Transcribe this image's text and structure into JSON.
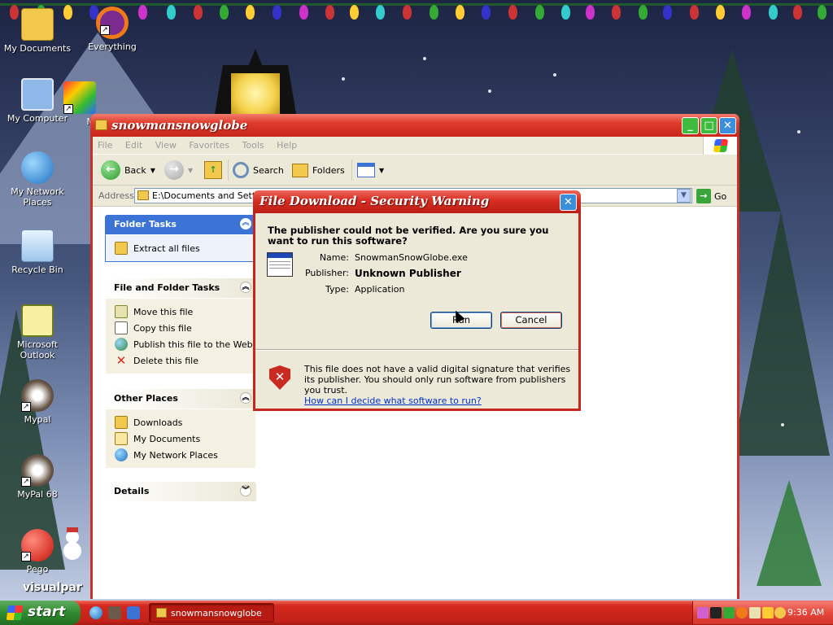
{
  "desktop": {
    "icons": [
      {
        "label": "My Documents"
      },
      {
        "label": "Everything"
      },
      {
        "label": "My Computer"
      },
      {
        "label": "M"
      },
      {
        "label": "My Network Places"
      },
      {
        "label": "Recycle Bin"
      },
      {
        "label": "Microsoft Outlook"
      },
      {
        "label": "Mypal"
      },
      {
        "label": "MyPal 68"
      },
      {
        "label": "Pego"
      },
      {
        "label": "visualpar"
      }
    ]
  },
  "explorer": {
    "title": "snowmansnowglobe",
    "menu": [
      "File",
      "Edit",
      "View",
      "Favorites",
      "Tools",
      "Help"
    ],
    "toolbar": {
      "back": "Back",
      "search": "Search",
      "folders": "Folders"
    },
    "address": {
      "label": "Address",
      "value": "E:\\Documents and Settings",
      "go": "Go"
    },
    "panels": {
      "folder_tasks": {
        "title": "Folder Tasks",
        "items": [
          "Extract all files"
        ]
      },
      "file_folder_tasks": {
        "title": "File and Folder Tasks",
        "items": [
          "Move this file",
          "Copy this file",
          "Publish this file to the Web",
          "Delete this file"
        ]
      },
      "other_places": {
        "title": "Other Places",
        "items": [
          "Downloads",
          "My Documents",
          "My Network Places"
        ]
      },
      "details": {
        "title": "Details"
      }
    }
  },
  "dialog": {
    "title": "File Download - Security Warning",
    "question": "The publisher could not be verified.  Are you sure you want to run this software?",
    "name_label": "Name:",
    "name_value": "SnowmanSnowGlobe.exe",
    "publisher_label": "Publisher:",
    "publisher_value": "Unknown Publisher",
    "type_label": "Type:",
    "type_value": "Application",
    "run_label": "Run",
    "cancel_label": "Cancel",
    "warning_text": "This file does not have a valid digital signature that verifies its publisher.  You should only run software from publishers you trust.",
    "help_link": "How can I decide what software to run?"
  },
  "taskbar": {
    "start_label": "start",
    "task_button": "snowmansnowglobe",
    "clock": "9:36 AM"
  },
  "colors": {
    "title_red": "#d62d22",
    "taskbar_red": "#c22219",
    "start_green": "#2f8a2f",
    "panel_blue": "#3b73d6"
  }
}
